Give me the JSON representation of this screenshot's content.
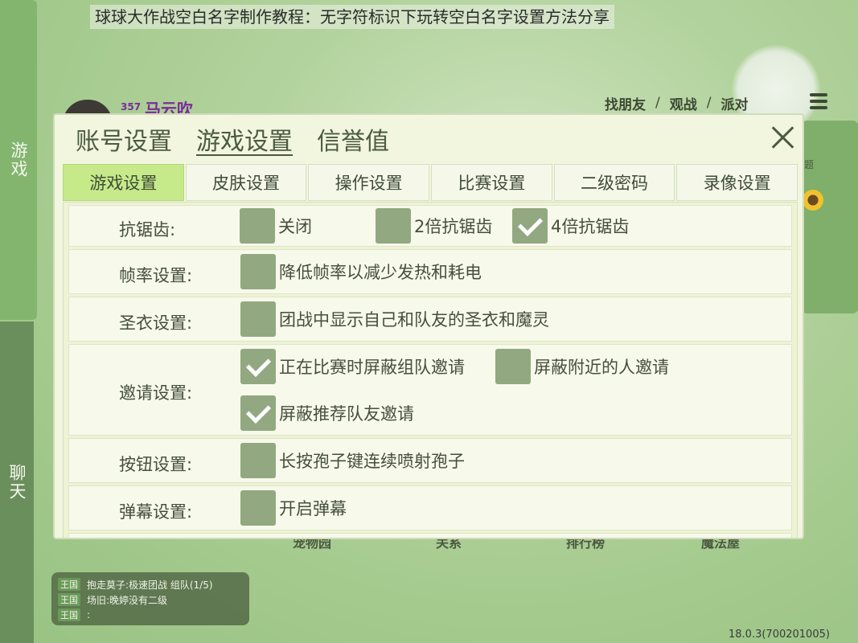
{
  "caption": "球球大作战空白名字制作教程：无字符标识下玩转空白名字设置方法分享",
  "rail": {
    "game_label": "游戏",
    "chat_label": "聊天"
  },
  "player": {
    "level": "357",
    "name": "马云吹"
  },
  "top_nav": {
    "find_friends": "找朋友",
    "sep1": "/",
    "watch": "观战",
    "sep2": "/",
    "party": "派对"
  },
  "side_peek": {
    "text": "题"
  },
  "bottom_labels": [
    "宠物园",
    "关系",
    "排行榜",
    "魔法屋"
  ],
  "chat": [
    {
      "tag": "王国",
      "text": "抱走莫子:极速团战 组队(1/5)"
    },
    {
      "tag": "王国",
      "text": "场旧:晚婷没有二级"
    },
    {
      "tag": "王国",
      "text": ":"
    }
  ],
  "version": "18.0.3(700201005)",
  "dialog": {
    "tabs": [
      "账号设置",
      "游戏设置",
      "信誉值"
    ],
    "active_tab": 1,
    "subtabs": [
      "游戏设置",
      "皮肤设置",
      "操作设置",
      "比赛设置",
      "二级密码",
      "录像设置"
    ],
    "active_subtab": 0,
    "settings": {
      "antialias": {
        "label": "抗锯齿:",
        "options": [
          {
            "label": "关闭",
            "checked": false
          },
          {
            "label": "2倍抗锯齿",
            "checked": false
          },
          {
            "label": "4倍抗锯齿",
            "checked": true
          }
        ]
      },
      "framerate": {
        "label": "帧率设置:",
        "options": [
          {
            "label": "降低帧率以减少发热和耗电",
            "checked": false
          }
        ]
      },
      "jersey": {
        "label": "圣衣设置:",
        "options": [
          {
            "label": "团战中显示自己和队友的圣衣和魔灵",
            "checked": false
          }
        ]
      },
      "invite": {
        "label": "邀请设置:",
        "options": [
          {
            "label": "正在比赛时屏蔽组队邀请",
            "checked": true
          },
          {
            "label": "屏蔽附近的人邀请",
            "checked": false
          },
          {
            "label": "屏蔽推荐队友邀请",
            "checked": true
          }
        ]
      },
      "button": {
        "label": "按钮设置:",
        "options": [
          {
            "label": "长按孢子键连续喷射孢子",
            "checked": false
          }
        ]
      },
      "barrage": {
        "label": "弹幕设置:",
        "options": [
          {
            "label": "开启弹幕",
            "checked": false
          }
        ]
      }
    }
  },
  "colors": {
    "accent_green": "#c6ea8a",
    "checkbox": "#92a881",
    "rail_green": "#83b56f",
    "name_purple": "#7b2d9a"
  }
}
